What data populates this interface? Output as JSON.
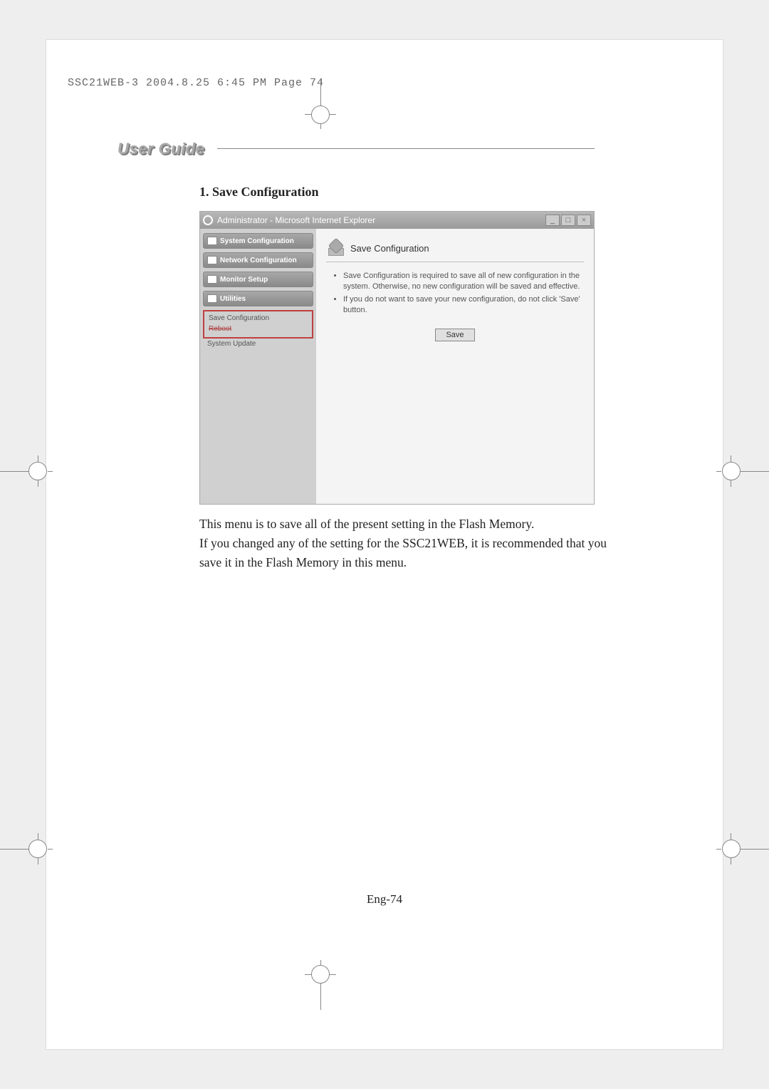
{
  "print_header": "SSC21WEB-3  2004.8.25  6:45 PM  Page 74",
  "heading": "User Guide",
  "section_title": "1. Save Configuration",
  "titlebar": "Administrator - Microsoft Internet Explorer",
  "win_min": "_",
  "win_max": "□",
  "win_close": "×",
  "nav": {
    "sys": "System Configuration",
    "net": "Network Configuration",
    "mon": "Monitor Setup",
    "util": "Utilities",
    "saveconf": "Save Configuration",
    "reboot": "Reboot",
    "update": "System Update"
  },
  "pane": {
    "title": "Save Configuration",
    "b1": "Save Configuration is required to save all of new configuration in the system. Otherwise, no new configuration will be saved and effective.",
    "b2": "If you do not want to save your new configuration, do not click 'Save' button.",
    "save": "Save"
  },
  "body": {
    "p1": "This menu is to save all of the present setting in the Flash Memory.",
    "p2": "If you changed any of the setting for the SSC21WEB, it is recommended that you save it in the Flash Memory in this menu."
  },
  "pagenum": "Eng-74"
}
